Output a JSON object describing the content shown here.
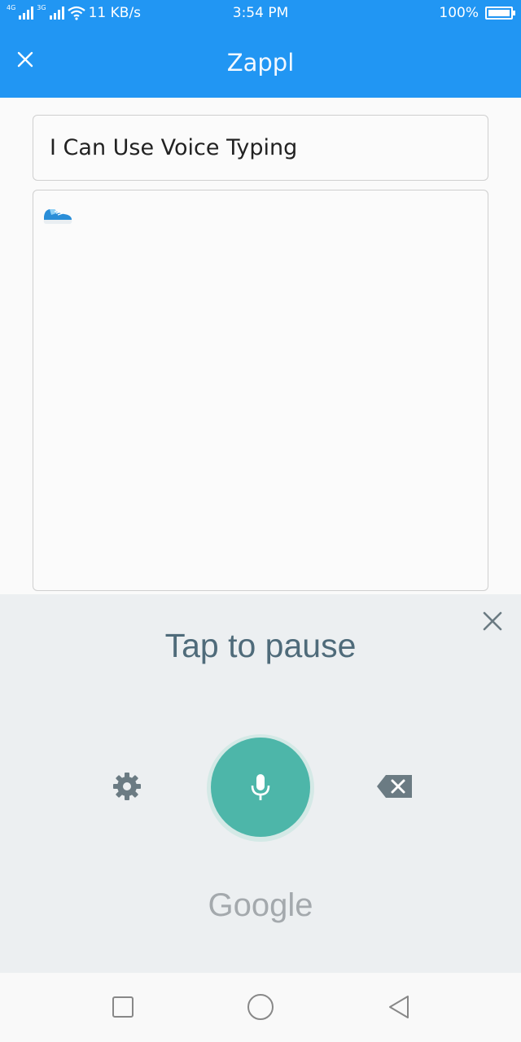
{
  "status_bar": {
    "net_1": "4G",
    "net_2": "3G",
    "speed": "11 KB/s",
    "time": "3:54 PM",
    "battery": "100%"
  },
  "app_bar": {
    "title": "Zappl",
    "close_icon": "close-icon"
  },
  "compose": {
    "title_value": "I Can Use Voice Typing",
    "body_emoji_icon": "shoe-icon"
  },
  "voice_input": {
    "prompt": "Tap to pause",
    "brand": "Google",
    "icons": [
      "settings-gear-icon",
      "microphone-icon",
      "backspace-icon",
      "close-icon"
    ],
    "accent_color": "#4db6a9"
  },
  "nav_bar": {
    "icons": [
      "recent-apps-square-icon",
      "home-circle-icon",
      "back-triangle-icon"
    ]
  },
  "colors": {
    "primary": "#2196f3",
    "panel_bg": "#eceff1"
  }
}
